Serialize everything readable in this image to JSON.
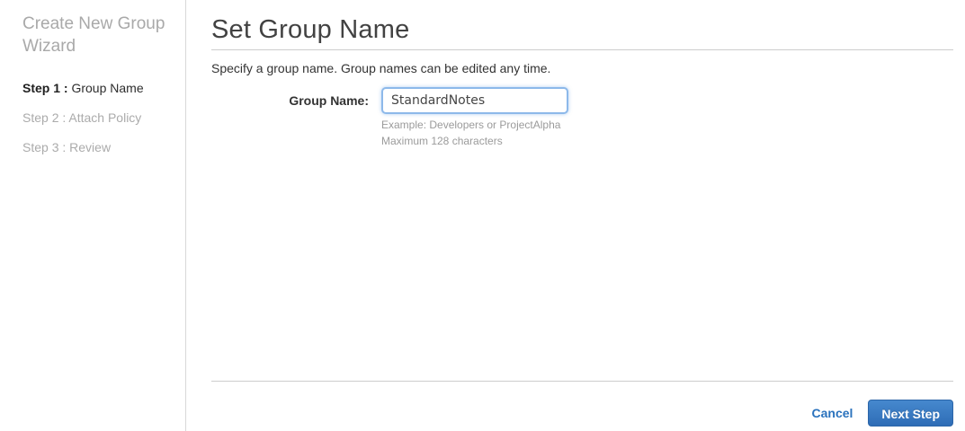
{
  "sidebar": {
    "title": "Create New Group Wizard",
    "steps": [
      {
        "prefix": "Step 1 : ",
        "label": "Group Name",
        "active": true
      },
      {
        "prefix": "Step 2 : ",
        "label": "Attach Policy",
        "active": false
      },
      {
        "prefix": "Step 3 : ",
        "label": "Review",
        "active": false
      }
    ]
  },
  "main": {
    "title": "Set Group Name",
    "description": "Specify a group name. Group names can be edited any time.",
    "form": {
      "group_name_label": "Group Name:",
      "group_name_value": "StandardNotes",
      "hint_example": "Example: Developers or ProjectAlpha",
      "hint_max": "Maximum 128 characters"
    },
    "footer": {
      "cancel_label": "Cancel",
      "next_label": "Next Step"
    }
  },
  "colors": {
    "accent_blue": "#2a72bd",
    "button_gradient_top": "#4689ce",
    "button_gradient_bottom": "#2e6db6",
    "input_focus_border": "#8db9ea",
    "divider": "#cccccc",
    "muted_text": "#a9a9a9"
  }
}
